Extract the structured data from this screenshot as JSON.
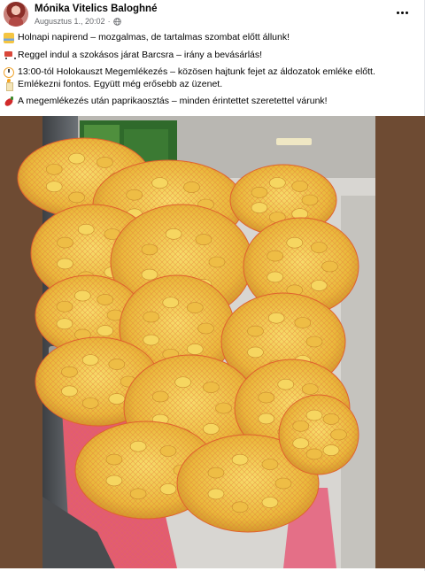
{
  "post": {
    "author": "Mónika Vitelics Baloghné",
    "date": "Augusztus 1., 20:02",
    "separator": "·",
    "privacy_icon": "globe-icon",
    "more_icon": "more-options-icon"
  },
  "body": {
    "lines": [
      {
        "icon": "bus-icon",
        "text": "Holnapi napirend – mozgalmas, de tartalmas szombat előtt állunk!"
      },
      {
        "icon": "shopping-cart-icon",
        "text": "Reggel indul a szokásos járat Barcsra – irány a bevásárlás!"
      },
      {
        "icon": "clock-icon",
        "text": "13:00-tól Holokauszt Megemlékezés – közösen hajtunk fejet az áldozatok emléke előtt."
      },
      {
        "icon": "candle-icon",
        "text": "Emlékezni fontos. Együtt még erősebb az üzenet."
      },
      {
        "icon": "hot-pepper-icon",
        "text": "A megemlékezés után paprikaosztás – minden érintettet szeretettel várunk!"
      }
    ]
  },
  "photo": {
    "subject": "van-full-of-pepper-sacks-photo"
  },
  "colors": {
    "name_text": "#050505",
    "meta_text": "#65676b",
    "sack_net": "#e8743b",
    "pepper_yellow": "#f3c84a"
  }
}
